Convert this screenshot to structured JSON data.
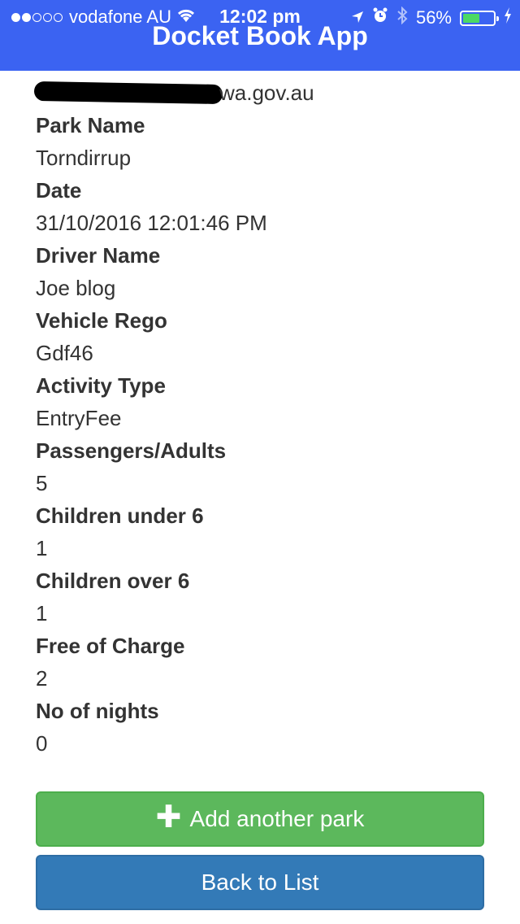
{
  "status_bar": {
    "carrier": "vodafone AU",
    "time": "12:02 pm",
    "battery_percent": "56%",
    "signal_icon": "signal-dots-icon",
    "wifi_icon": "wifi-icon",
    "location_icon": "location-arrow-icon",
    "alarm_icon": "alarm-clock-icon",
    "bluetooth_icon": "bluetooth-icon",
    "charging_icon": "charging-bolt-icon",
    "battery_color": "#4cd964"
  },
  "header": {
    "title": "Docket Book App",
    "background": "#3b63f2"
  },
  "email": {
    "visible_suffix": "wa.gov.au"
  },
  "fields": [
    {
      "label": "Park Name",
      "value": "Torndirrup"
    },
    {
      "label": "Date",
      "value": "31/10/2016 12:01:46 PM"
    },
    {
      "label": "Driver Name",
      "value": "Joe blog"
    },
    {
      "label": "Vehicle Rego",
      "value": "Gdf46"
    },
    {
      "label": "Activity Type",
      "value": "EntryFee"
    },
    {
      "label": "Passengers/Adults",
      "value": "5"
    },
    {
      "label": "Children under 6",
      "value": "1"
    },
    {
      "label": "Children over 6",
      "value": "1"
    },
    {
      "label": "Free of Charge",
      "value": "2"
    },
    {
      "label": "No of nights",
      "value": "0"
    }
  ],
  "buttons": {
    "add_park": "Add another park",
    "add_park_icon": "plus-icon",
    "add_park_color": "#5cb85c",
    "back_to_list": "Back to List",
    "back_to_list_color": "#337ab7"
  }
}
